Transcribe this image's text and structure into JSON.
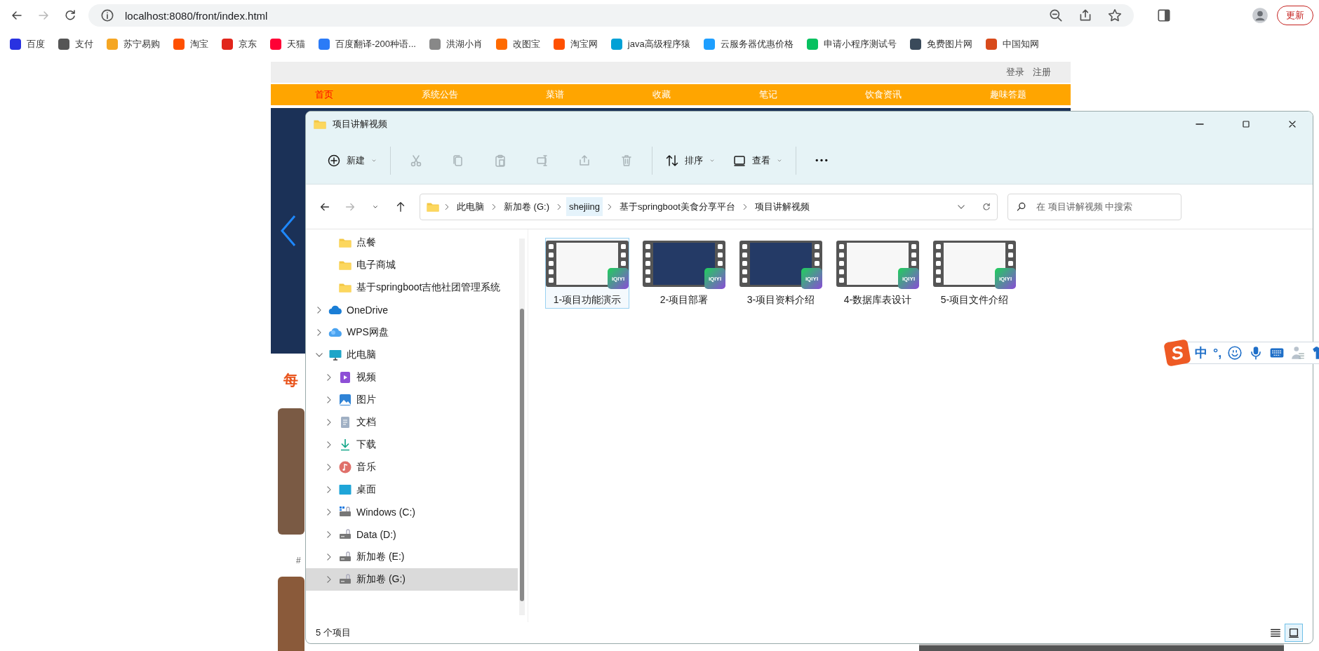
{
  "browser": {
    "nav_buttons": [
      {
        "kind": "back",
        "disabled": false
      },
      {
        "kind": "forward",
        "disabled": true
      },
      {
        "kind": "reload",
        "disabled": false
      }
    ],
    "url": "localhost:8080/front/index.html",
    "update_button": "更新",
    "bookmarks": [
      {
        "label": "百度",
        "color": "#2932e1"
      },
      {
        "label": "支付",
        "color": "#555555"
      },
      {
        "label": "苏宁易购",
        "color": "#f5a623"
      },
      {
        "label": "淘宝",
        "color": "#ff5000"
      },
      {
        "label": "京东",
        "color": "#e1251b"
      },
      {
        "label": "天猫",
        "color": "#ff0036"
      },
      {
        "label": "百度翻译-200种语...",
        "color": "#2b7bf7"
      },
      {
        "label": "洪湖小肖",
        "color": "#888888"
      },
      {
        "label": "改图宝",
        "color": "#ff6a00"
      },
      {
        "label": "淘宝网",
        "color": "#ff5000"
      },
      {
        "label": "java高级程序猿",
        "color": "#00a1d6"
      },
      {
        "label": "云服务器优惠价格",
        "color": "#1e9fff"
      },
      {
        "label": "申请小程序测试号",
        "color": "#07c160"
      },
      {
        "label": "免费图片网",
        "color": "#3a4a5a"
      },
      {
        "label": "中国知网",
        "color": "#d84a1b"
      }
    ]
  },
  "site": {
    "auth_links": [
      "登录",
      "注册"
    ],
    "nav": [
      {
        "label": "首页",
        "selected": true
      },
      {
        "label": "系统公告",
        "selected": false
      },
      {
        "label": "菜谱",
        "selected": false
      },
      {
        "label": "收藏",
        "selected": false
      },
      {
        "label": "笔记",
        "selected": false
      },
      {
        "label": "饮食资讯",
        "selected": false
      },
      {
        "label": "趣味答题",
        "selected": false
      }
    ],
    "section_heading": "每",
    "caption": "#"
  },
  "explorer": {
    "title": "项目讲解视频",
    "toolbar": {
      "groups": [
        [
          {
            "kind": "new",
            "label": "新建",
            "disabled": false
          }
        ],
        [
          {
            "kind": "cut",
            "disabled": true
          },
          {
            "kind": "copy",
            "disabled": true
          },
          {
            "kind": "paste",
            "disabled": true
          },
          {
            "kind": "rename",
            "disabled": true
          },
          {
            "kind": "share",
            "disabled": true
          },
          {
            "kind": "delete",
            "disabled": true
          }
        ],
        [
          {
            "kind": "sort",
            "label": "排序",
            "disabled": false
          },
          {
            "kind": "view",
            "label": "查看",
            "disabled": false
          }
        ],
        [
          {
            "kind": "more",
            "disabled": false
          }
        ]
      ]
    },
    "nav_buttons": [
      {
        "kind": "back",
        "disabled": false
      },
      {
        "kind": "forward",
        "disabled": true
      },
      {
        "kind": "recent",
        "disabled": false
      },
      {
        "kind": "up",
        "disabled": false
      }
    ],
    "breadcrumbs": [
      {
        "label": "此电脑",
        "hovered": false
      },
      {
        "label": "新加卷 (G:)",
        "hovered": false
      },
      {
        "label": "shejiing",
        "hovered": true
      },
      {
        "label": "基于springboot美食分享平台",
        "hovered": false
      },
      {
        "label": "项目讲解视频",
        "hovered": false
      }
    ],
    "search": {
      "placeholder": "在 项目讲解视频 中搜索"
    },
    "sidebar": {
      "continued_items": [
        {
          "label": "点餐",
          "kind": "folder",
          "selected": false
        },
        {
          "label": "电子商城",
          "kind": "folder",
          "selected": false
        },
        {
          "label": "基于springboot吉他社团管理系统",
          "kind": "folder",
          "selected": false
        }
      ],
      "items": [
        {
          "label": "OneDrive",
          "kind": "onedrive",
          "expanded": false,
          "selected": false
        },
        {
          "label": "WPS网盘",
          "kind": "cloud",
          "expanded": false,
          "selected": false
        },
        {
          "label": "此电脑",
          "kind": "computer",
          "expanded": true,
          "selected": false,
          "children": [
            {
              "label": "视频",
              "kind": "videos",
              "expanded": false,
              "selected": false
            },
            {
              "label": "图片",
              "kind": "pictures",
              "expanded": false,
              "selected": false
            },
            {
              "label": "文档",
              "kind": "documents",
              "expanded": false,
              "selected": false
            },
            {
              "label": "下载",
              "kind": "downloads",
              "expanded": false,
              "selected": false
            },
            {
              "label": "音乐",
              "kind": "music",
              "expanded": false,
              "selected": false
            },
            {
              "label": "桌面",
              "kind": "desktop",
              "expanded": false,
              "selected": false
            },
            {
              "label": "Windows (C:)",
              "kind": "system-drive",
              "expanded": false,
              "selected": false
            },
            {
              "label": "Data (D:)",
              "kind": "drive",
              "expanded": false,
              "selected": false
            },
            {
              "label": "新加卷 (E:)",
              "kind": "drive",
              "expanded": false,
              "selected": false
            },
            {
              "label": "新加卷 (G:)",
              "kind": "drive",
              "expanded": false,
              "selected": true
            }
          ]
        }
      ]
    },
    "files": [
      {
        "label": "1-项目功能演示",
        "kind": "light",
        "badge": "iQIYI",
        "selected": true
      },
      {
        "label": "2-项目部署",
        "kind": "dark",
        "badge": "iQIYI",
        "selected": false
      },
      {
        "label": "3-项目资料介绍",
        "kind": "dark",
        "badge": "iQIYI",
        "selected": false
      },
      {
        "label": "4-数据库表设计",
        "kind": "light",
        "badge": "iQIYI",
        "selected": false
      },
      {
        "label": "5-项目文件介绍",
        "kind": "light",
        "badge": "iQIYI",
        "selected": false
      }
    ],
    "status": "5 个项目",
    "views": [
      {
        "kind": "details",
        "selected": false
      },
      {
        "kind": "tiles",
        "selected": true
      }
    ]
  },
  "ime": {
    "logo": "S",
    "mode": "中",
    "punctuation": "°,"
  }
}
